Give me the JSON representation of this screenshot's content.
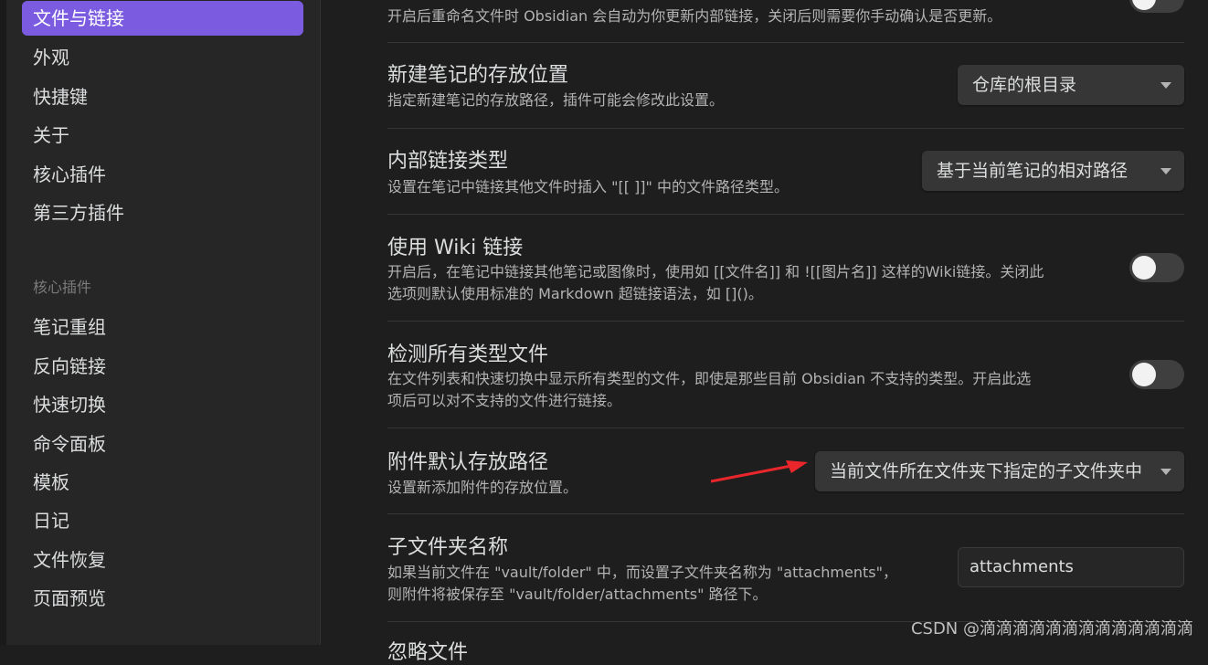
{
  "sidebar": {
    "items": [
      {
        "label": "文件与链接",
        "active": true
      },
      {
        "label": "外观"
      },
      {
        "label": "快捷键"
      },
      {
        "label": "关于"
      },
      {
        "label": "核心插件"
      },
      {
        "label": "第三方插件"
      }
    ],
    "plugins_heading": "核心插件",
    "plugin_items": [
      {
        "label": "笔记重组"
      },
      {
        "label": "反向链接"
      },
      {
        "label": "快速切换"
      },
      {
        "label": "命令面板"
      },
      {
        "label": "模板"
      },
      {
        "label": "日记"
      },
      {
        "label": "文件恢复"
      },
      {
        "label": "页面预览"
      }
    ]
  },
  "settings": {
    "auto_update_links": {
      "desc": "开启后重命名文件时 Obsidian 会自动为你更新内部链接，关闭后则需要你手动确认是否更新。"
    },
    "new_note_location": {
      "title": "新建笔记的存放位置",
      "desc": "指定新建笔记的存放路径，插件可能会修改此设置。",
      "value": "仓库的根目录"
    },
    "link_type": {
      "title": "内部链接类型",
      "desc": "设置在笔记中链接其他文件时插入 \"[[ ]]\" 中的文件路径类型。",
      "value": "基于当前笔记的相对路径"
    },
    "wiki_links": {
      "title": "使用 Wiki 链接",
      "desc_line1": "开启后，在笔记中链接其他笔记或图像时，使用如 [[文件名]] 和 ![[图片名]] 这样的Wiki链接。关闭此",
      "desc_line2": "选项则默认使用标准的 Markdown 超链接语法，如 []()。",
      "enabled": false
    },
    "detect_all_types": {
      "title": "检测所有类型文件",
      "desc_line1": "在文件列表和快速切换中显示所有类型的文件，即使是那些目前 Obsidian 不支持的类型。开启此选",
      "desc_line2": "项后可以对不支持的文件进行链接。",
      "enabled": false
    },
    "attachment_location": {
      "title": "附件默认存放路径",
      "desc": "设置新添加附件的存放位置。",
      "value": "当前文件所在文件夹下指定的子文件夹中"
    },
    "subfolder_name": {
      "title": "子文件夹名称",
      "desc_line1": "如果当前文件在 \"vault/folder\" 中，而设置子文件夹名称为 \"attachments\"，",
      "desc_line2": "则附件将被保存至 \"vault/folder/attachments\" 路径下。",
      "value": "attachments"
    },
    "next_partial": {
      "title": "忽略文件"
    }
  },
  "watermark": "CSDN @滴滴滴滴滴滴滴滴滴滴滴滴滴",
  "colors": {
    "accent": "#7b5ce0",
    "annotation_arrow": "#e8262b"
  }
}
